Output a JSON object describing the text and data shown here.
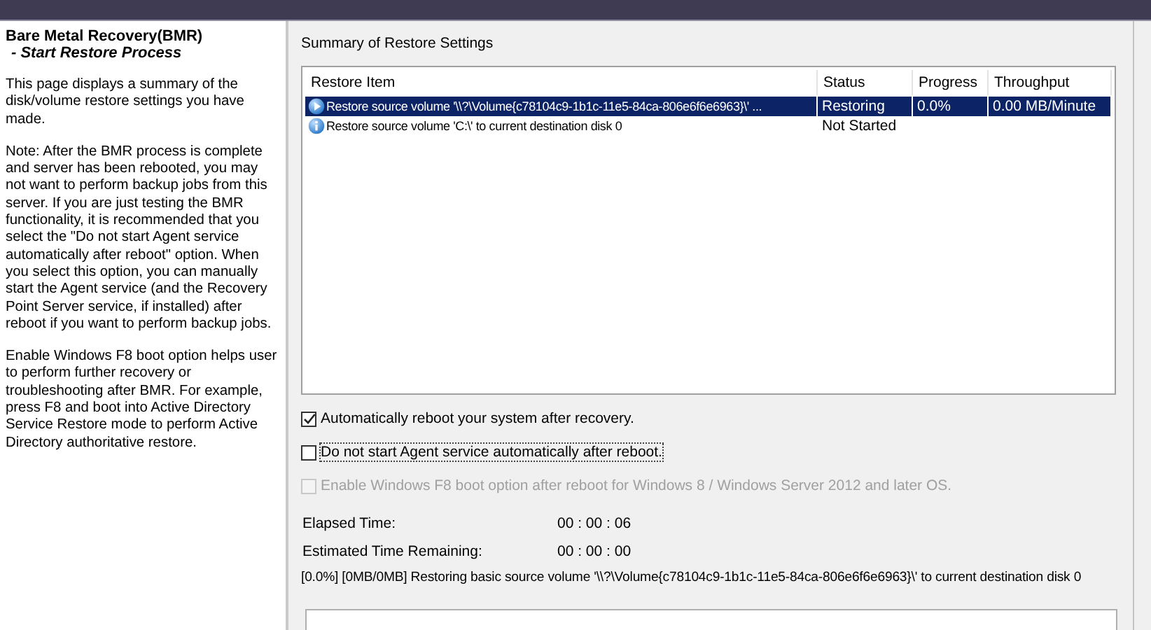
{
  "sidebar": {
    "title": "Bare Metal Recovery(BMR)",
    "subtitle": "- Start Restore Process",
    "paragraphs": [
      "This page displays a summary of the disk/volume restore settings you have made.",
      "Note: After the BMR process is complete and server has been rebooted, you may not want to perform backup jobs from this server. If you are just testing the BMR functionality, it is recommended that you select the \"Do not start Agent service automatically after reboot\" option. When you select this option, you can manually start the Agent service (and the Recovery Point Server service, if installed) after reboot if you want to perform backup jobs.",
      "Enable Windows F8 boot option helps user to perform further recovery or troubleshooting after BMR. For example, press F8 and boot into Active Directory Service Restore mode to perform Active Directory authoritative restore."
    ]
  },
  "summary": {
    "heading": "Summary of Restore Settings",
    "table": {
      "columns": [
        "Restore Item",
        "Status",
        "Progress",
        "Throughput"
      ],
      "rows": [
        {
          "kind": "running",
          "selected": true,
          "cells": [
            "Restore source volume '\\\\?\\Volume{c78104c9-1b1c-11e5-84ca-806e6f6e6963}\\' ...",
            "Restoring",
            "0.0%",
            "0.00 MB/Minute"
          ]
        },
        {
          "kind": "info",
          "selected": false,
          "cells": [
            "Restore source volume 'C:\\' to current destination disk 0",
            "Not Started"
          ]
        }
      ]
    }
  },
  "options": [
    {
      "label": "Automatically reboot your system after recovery.",
      "checked": true,
      "disabled": false,
      "focused": false
    },
    {
      "label": "Do not start Agent service automatically after reboot.",
      "checked": false,
      "disabled": false,
      "focused": true
    },
    {
      "label": "Enable Windows F8 boot option after reboot for Windows 8 / Windows Server 2012 and later OS.",
      "checked": false,
      "disabled": true,
      "focused": false
    }
  ],
  "times": [
    {
      "label": "Elapsed Time:",
      "value": "00 : 00 : 06"
    },
    {
      "label": "Estimated Time Remaining:",
      "value": "00 : 00 : 00"
    }
  ],
  "status_message": "[0.0%] [0MB/0MB] Restoring basic source volume '\\\\?\\Volume{c78104c9-1b1c-11e5-84ca-806e6f6e6963}\\' to current destination disk 0"
}
